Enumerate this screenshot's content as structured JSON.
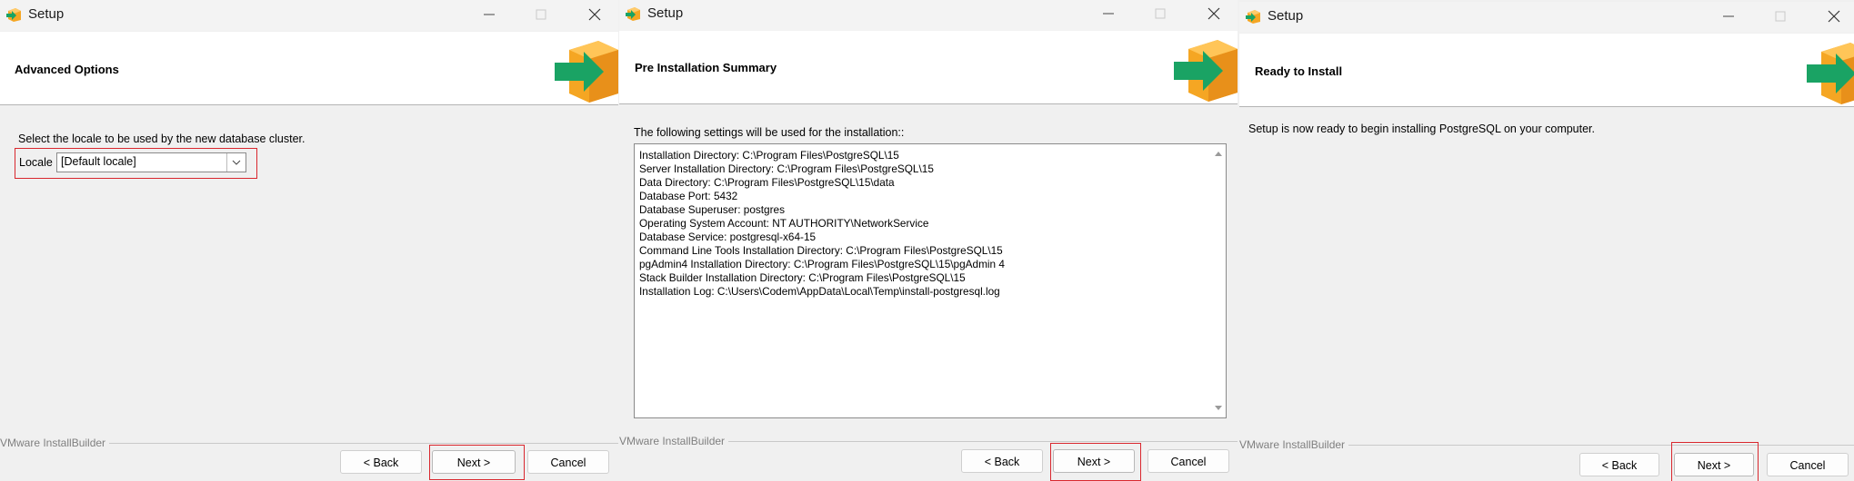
{
  "windows": [
    {
      "title": "Setup",
      "header_title": "Advanced Options",
      "prompt": "Select the locale to be used by the new database cluster.",
      "locale_label": "Locale",
      "locale_value": "[Default locale]",
      "footer_brand": "VMware InstallBuilder",
      "buttons": {
        "back": "< Back",
        "next": "Next >",
        "cancel": "Cancel"
      }
    },
    {
      "title": "Setup",
      "header_title": "Pre Installation Summary",
      "prompt": "The following settings will be used for the installation::",
      "summary_lines": [
        "Installation Directory: C:\\Program Files\\PostgreSQL\\15",
        "Server Installation Directory: C:\\Program Files\\PostgreSQL\\15",
        "Data Directory: C:\\Program Files\\PostgreSQL\\15\\data",
        "Database Port: 5432",
        "Database Superuser: postgres",
        "Operating System Account: NT AUTHORITY\\NetworkService",
        "Database Service: postgresql-x64-15",
        "Command Line Tools Installation Directory: C:\\Program Files\\PostgreSQL\\15",
        "pgAdmin4 Installation Directory: C:\\Program Files\\PostgreSQL\\15\\pgAdmin 4",
        "Stack Builder Installation Directory: C:\\Program Files\\PostgreSQL\\15",
        "Installation Log: C:\\Users\\Codem\\AppData\\Local\\Temp\\install-postgresql.log"
      ],
      "footer_brand": "VMware InstallBuilder",
      "buttons": {
        "back": "< Back",
        "next": "Next >",
        "cancel": "Cancel"
      }
    },
    {
      "title": "Setup",
      "header_title": "Ready to Install",
      "prompt": "Setup is now ready to begin installing PostgreSQL on your computer.",
      "footer_brand": "VMware InstallBuilder",
      "buttons": {
        "back": "< Back",
        "next": "Next >",
        "cancel": "Cancel"
      }
    }
  ],
  "icons": {
    "app": "installer-box-icon",
    "minimize": "minimize-icon",
    "maximize": "maximize-icon",
    "close": "close-icon",
    "header_logo": "installer-box-arrow-icon",
    "dropdown": "chevron-down-icon",
    "scroll_up": "scroll-up-arrow-icon",
    "scroll_down": "scroll-down-arrow-icon"
  },
  "colors": {
    "highlight_frame": "#d9272e",
    "logo_box": "#f5a623",
    "logo_arrow": "#1aa364"
  }
}
